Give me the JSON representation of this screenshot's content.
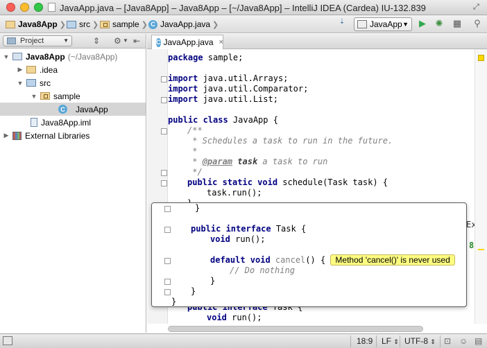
{
  "window": {
    "title": "JavaApp.java – [Java8App] – Java8App – [~/Java8App] – IntelliJ IDEA (Cardea) IU-132.839"
  },
  "breadcrumbs": [
    "Java8App",
    "src",
    "sample",
    "JavaApp.java"
  ],
  "toolbar": {
    "run_config": "JavaApp",
    "icons": [
      "make-icon",
      "run-icon",
      "debug-icon",
      "coverage-icon",
      "search-icon"
    ]
  },
  "project_panel": {
    "view_label": "Project",
    "tree": [
      {
        "label": "Java8App",
        "extra": "(~/Java8App)",
        "expanded": true
      },
      {
        "label": ".idea",
        "expanded": false
      },
      {
        "label": "src",
        "expanded": true
      },
      {
        "label": "sample",
        "expanded": true
      },
      {
        "label": "JavaApp",
        "selected": true
      },
      {
        "label": "Java8App.iml"
      },
      {
        "label": "External Libraries",
        "expanded": false
      }
    ]
  },
  "editor": {
    "tab_label": "JavaApp.java",
    "lines": [
      {
        "kw": "package",
        "rest": " sample;"
      },
      {
        "kw": "import",
        "rest": " java.util.Arrays;"
      },
      {
        "kw": "import",
        "rest": " java.util.Comparator;"
      },
      {
        "kw": "import",
        "rest": " java.util.List;"
      },
      {
        "kw": "public class",
        "rest": " JavaApp {"
      },
      {
        "comment": "/**"
      },
      {
        "comment": " * Schedules a task to run in the future."
      },
      {
        "comment": " *"
      },
      {
        "comment_pre": " * ",
        "tag": "@param",
        "param": "task",
        "comment_post": " a task to run"
      },
      {
        "comment": " */"
      },
      {
        "kw": "public static void",
        "rest": " schedule(Task task) {"
      },
      {
        "rest": "task.run();"
      },
      {
        "rest": "}"
      },
      {
        "kw": "public interface",
        "rest": " Task {"
      },
      {
        "kw": "void",
        "rest": " run();"
      }
    ],
    "edge_glyphs": {
      "ex": "Ex",
      "eight": "8"
    }
  },
  "preview_popup": {
    "lines": [
      {
        "rest": "}"
      },
      {
        "kw": "public interface",
        "rest": " Task {"
      },
      {
        "kw": "void",
        "rest": " run();"
      },
      {
        "kw": "default void",
        "unused": " cancel",
        "rest": "() {"
      },
      {
        "comment": "// Do nothing"
      },
      {
        "rest": "}"
      },
      {
        "rest": "}"
      },
      {
        "rest": "}"
      }
    ],
    "inspection_hint": "Method 'cancel()' is never used"
  },
  "status_bar": {
    "position": "18:9",
    "line_separator": "LF",
    "encoding": "UTF-8"
  }
}
